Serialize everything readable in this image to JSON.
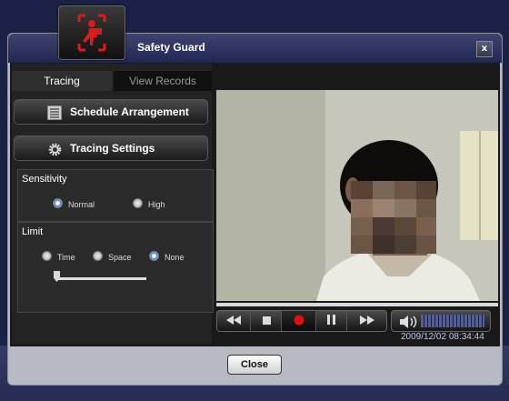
{
  "window": {
    "title": "Safety Guard",
    "close_x": "x"
  },
  "tabs": [
    {
      "label": "Tracing",
      "active": true
    },
    {
      "label": "View Records",
      "active": false
    }
  ],
  "buttons": {
    "schedule": "Schedule Arrangement",
    "tracing_settings": "Tracing Settings",
    "close": "Close"
  },
  "sensitivity": {
    "title": "Sensitivity",
    "options": [
      "Normal",
      "High"
    ],
    "selected": "Normal"
  },
  "limit": {
    "title": "Limit",
    "options": [
      "Time",
      "Space",
      "None"
    ],
    "selected": "None",
    "slider_value": 0
  },
  "player": {
    "timestamp": "2009/12/02 08:34:44",
    "recording": true
  },
  "icons": {
    "app": "app-logo-icon",
    "schedule": "calendar-list-icon",
    "settings": "gear-icon",
    "rewind": "rewind-icon",
    "stop": "stop-icon",
    "record": "record-icon",
    "pause": "pause-icon",
    "forward": "fast-forward-icon",
    "volume": "speaker-icon"
  },
  "colors": {
    "background": "#1c2147",
    "window_frame": "#b8bac3",
    "record_red": "#e01010",
    "radio_selected": "#3f7fd8",
    "timestamp_text": "#bfc6e8"
  }
}
